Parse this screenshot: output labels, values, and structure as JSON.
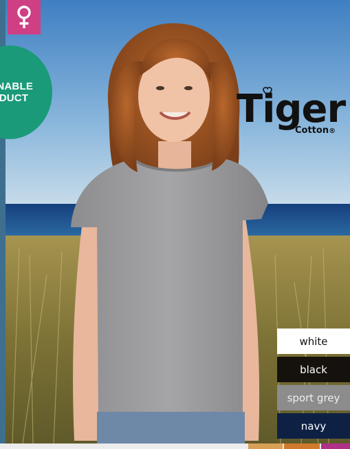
{
  "brand": {
    "logo_main": "Tiger",
    "logo_sub": "Cotton",
    "logo_mark": "®",
    "logo_color": "#111111"
  },
  "badges": {
    "gender_icon": "female-symbol-icon",
    "gender_color": "#cf3f84",
    "sustainable_line1": "AINABLE",
    "sustainable_line2": "ODUCT",
    "sustainable_color": "#1a9a79"
  },
  "colors": {
    "options": [
      {
        "label": "white",
        "bg": "#ffffff",
        "fg": "#111111"
      },
      {
        "label": "black",
        "bg": "#15110d",
        "fg": "#ffffff"
      },
      {
        "label": "sport grey",
        "bg": "#8c8c8c",
        "fg": "#eeeeee"
      },
      {
        "label": "navy",
        "bg": "#0e2145",
        "fg": "#ffffff"
      }
    ]
  },
  "bottom_bar_colors": [
    "#d8a055",
    "#cf7a2c",
    "#b0308a"
  ]
}
